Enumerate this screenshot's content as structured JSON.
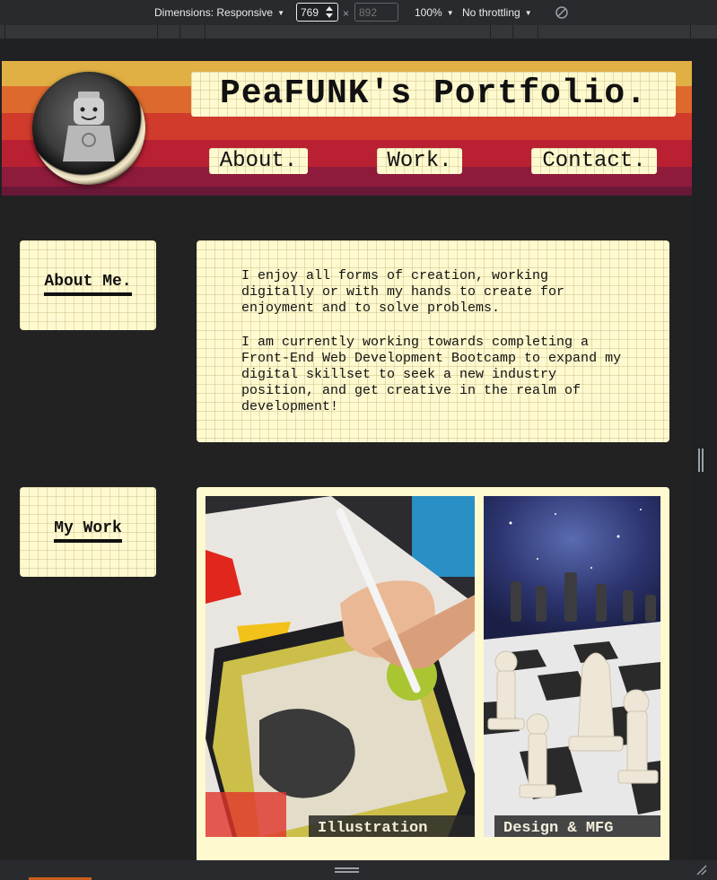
{
  "devtools": {
    "dimensions_label": "Dimensions: Responsive",
    "width_value": "769",
    "height_placeholder": "892",
    "times": "×",
    "zoom_label": "100%",
    "throttle_label": "No throttling"
  },
  "site": {
    "title": "PeaFUNK's Portfolio.",
    "nav": [
      "About.",
      "Work.",
      "Contact."
    ],
    "about_heading": "About Me.",
    "about_paragraphs": [
      "I enjoy all forms of creation, working digitally or with my hands to create for enjoyment and to solve problems.",
      "I am currently working towards completing a Front-End Web Development Bootcamp to expand my digital skillset to seek a new industry position, and get creative in the realm of development!"
    ],
    "work_heading": "My Work",
    "projects": [
      {
        "caption": "Illustration"
      },
      {
        "caption": "Design & MFG"
      }
    ]
  },
  "colors": {
    "devtools_bg": "#292a2d",
    "page_bg": "#222222",
    "paper": "#fff9cf",
    "stripes": [
      "#e1b045",
      "#dd6a2c",
      "#d13b2b",
      "#b92133",
      "#8e1b3c",
      "#6a1838"
    ]
  },
  "icons": {
    "rotate": "rotate-icon",
    "spinner": "spinner-icon",
    "corner": "resize-corner-icon"
  }
}
